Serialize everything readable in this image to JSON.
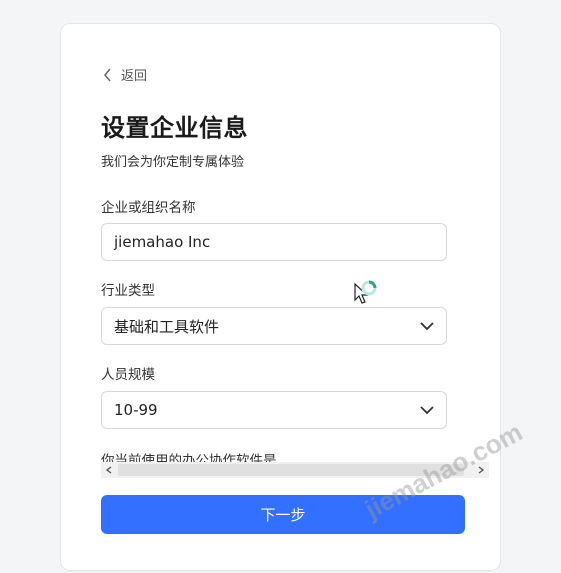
{
  "nav": {
    "back_label": "返回"
  },
  "header": {
    "title": "设置企业信息",
    "subtitle": "我们会为你定制专属体验"
  },
  "form": {
    "company_name": {
      "label": "企业或组织名称",
      "value": "jiemahao Inc"
    },
    "industry": {
      "label": "行业类型",
      "selected": "基础和工具软件"
    },
    "staff_size": {
      "label": "人员规模",
      "selected": "10-99"
    },
    "office_software": {
      "label": "你当前使用的办公协作软件是"
    }
  },
  "actions": {
    "next_label": "下一步"
  },
  "watermark": "jiemahao.com",
  "colors": {
    "primary": "#3370ff",
    "background": "#f4f5f7",
    "card": "#ffffff"
  },
  "icons": {
    "back": "chevron-left-icon",
    "dropdown": "chevron-down-icon",
    "cursor": "busy-cursor-icon"
  }
}
